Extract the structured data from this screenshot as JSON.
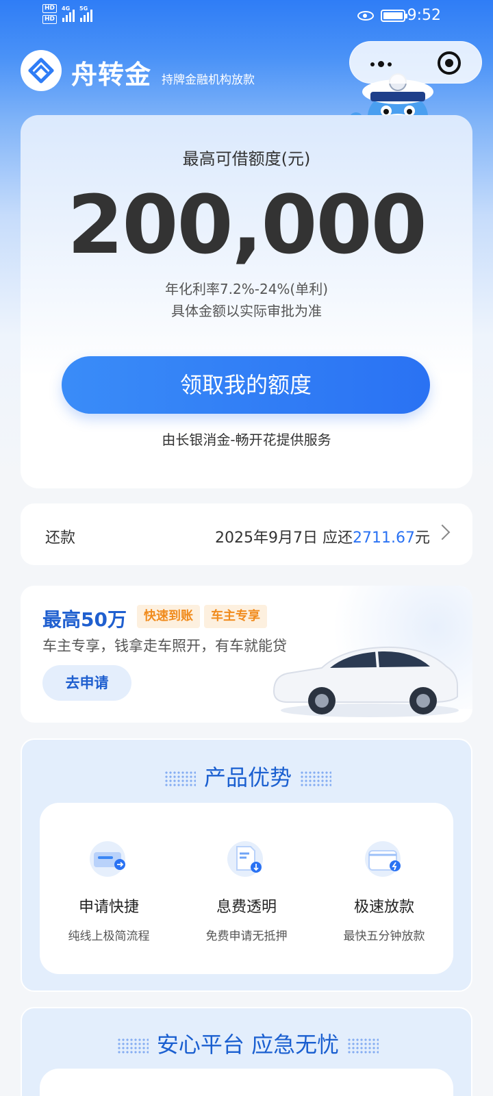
{
  "status_bar": {
    "hd_1": "HD",
    "hd_2": "HD",
    "network_1": "4G",
    "network_2": "5G",
    "time": "9:52"
  },
  "header": {
    "brand": "舟转金",
    "subtitle": "持牌金融机构放款"
  },
  "credit": {
    "label": "最高可借额度(元)",
    "amount": "200,000",
    "rate": "年化利率7.2%-24%(单利)",
    "note": "具体金额以实际审批为准",
    "button": "领取我的额度",
    "provider": "由长银消金-畅开花提供服务"
  },
  "repay": {
    "label": "还款",
    "date_text": "2025年9月7日 应还",
    "amount": "2711.67",
    "unit": "元"
  },
  "promo": {
    "title": "最高50万",
    "tags": [
      "快速到账",
      "车主专享"
    ],
    "desc": "车主专享，钱拿走车照开，有车就能贷",
    "button": "去申请"
  },
  "advantages": {
    "title": "产品优势",
    "items": [
      {
        "title": "申请快捷",
        "desc": "纯线上极简流程",
        "icon": "card-icon"
      },
      {
        "title": "息费透明",
        "desc": "免费申请无抵押",
        "icon": "document-icon"
      },
      {
        "title": "极速放款",
        "desc": "最快五分钟放款",
        "icon": "wallet-icon"
      }
    ]
  },
  "safety": {
    "title": "安心平台 应急无忧"
  },
  "colors": {
    "primary": "#2a72f3",
    "title_blue": "#1a5fd0",
    "tag_orange": "#f08b1d"
  }
}
